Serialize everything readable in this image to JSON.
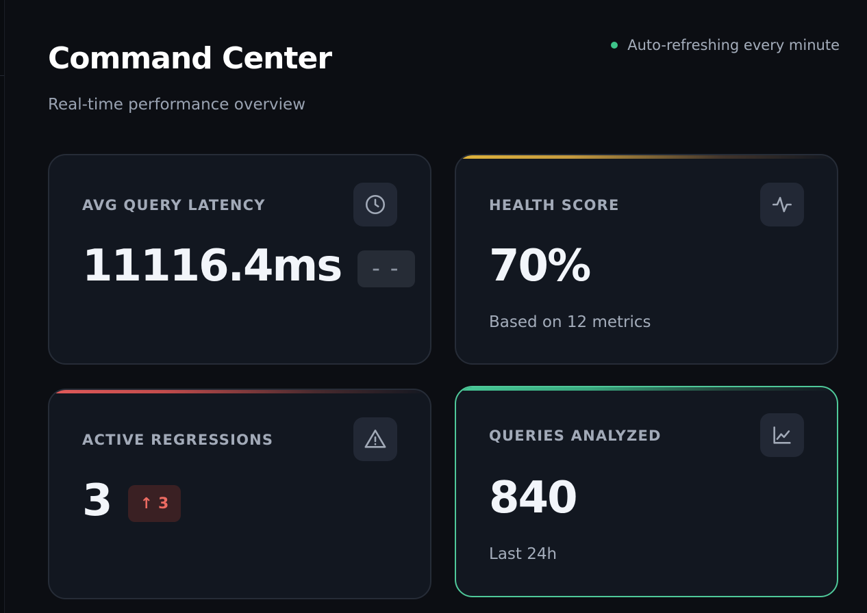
{
  "header": {
    "title": "Command Center",
    "subtitle": "Real-time performance overview",
    "status_text": "Auto-refreshing every minute",
    "status_color": "#3ec48a"
  },
  "cards": [
    {
      "label": "AVG QUERY LATENCY",
      "value": "11116.4ms",
      "badge": "– –",
      "icon": "clock-icon"
    },
    {
      "label": "HEALTH SCORE",
      "value": "70%",
      "footnote": "Based on 12 metrics",
      "icon": "activity-pulse-icon",
      "accent_color": "#e0b43c"
    },
    {
      "label": "ACTIVE REGRESSIONS",
      "value": "3",
      "badge_arrow": "↑",
      "badge": "3",
      "icon": "warning-triangle-icon",
      "accent_color": "#e05a5a"
    },
    {
      "label": "QUERIES ANALYZED",
      "value": "840",
      "footnote": "Last 24h",
      "icon": "line-chart-icon",
      "accent_color": "#47c896"
    }
  ]
}
